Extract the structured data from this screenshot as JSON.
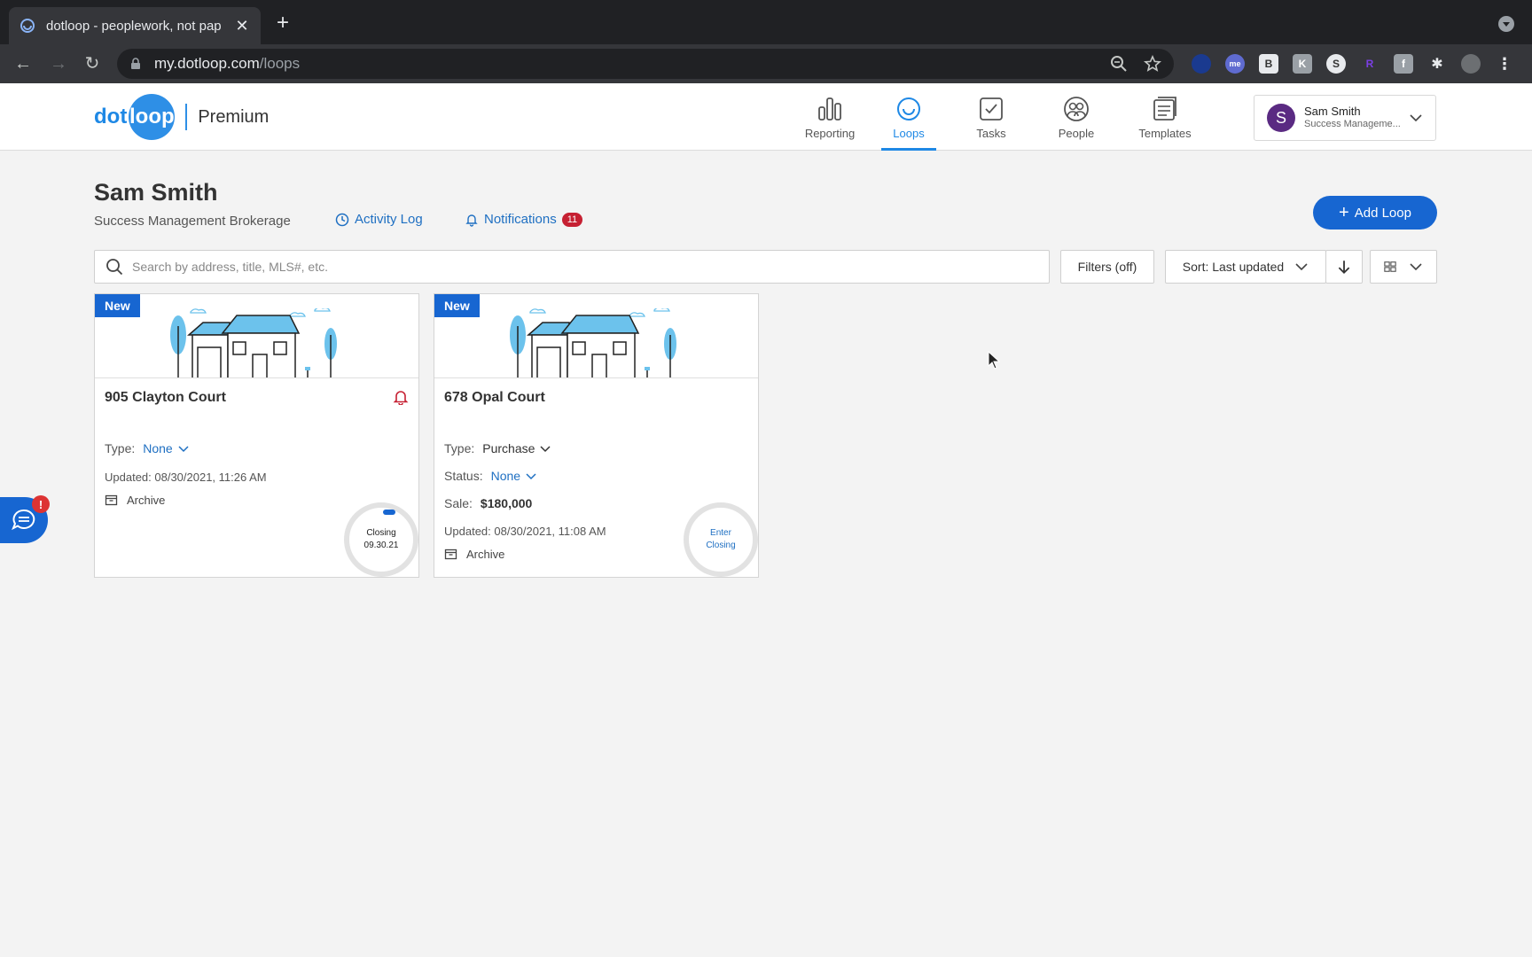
{
  "browser": {
    "tab_title": "dotloop - peoplework, not pap",
    "url_host": "my.dotloop.com",
    "url_path": "/loops"
  },
  "header": {
    "logo_dot": "dot",
    "logo_loop": "loop",
    "plan": "Premium",
    "nav": [
      {
        "label": "Reporting",
        "icon": "bar-chart-icon"
      },
      {
        "label": "Loops",
        "icon": "loop-icon",
        "active": true
      },
      {
        "label": "Tasks",
        "icon": "checkbox-icon"
      },
      {
        "label": "People",
        "icon": "people-icon"
      },
      {
        "label": "Templates",
        "icon": "templates-icon"
      }
    ],
    "user": {
      "initial": "S",
      "name": "Sam Smith",
      "org": "Success Manageme..."
    }
  },
  "page": {
    "title": "Sam Smith",
    "brokerage": "Success Management Brokerage",
    "activity_log": "Activity Log",
    "notifications": "Notifications",
    "notifications_count": "11",
    "add_loop": "Add Loop"
  },
  "controls": {
    "search_placeholder": "Search by address, title, MLS#, etc.",
    "filters": "Filters (off)",
    "sort": "Sort: Last updated"
  },
  "loops": [
    {
      "tag": "New",
      "address": "905 Clayton Court",
      "type_label": "Type:",
      "type_value": "None",
      "updated": "Updated: 08/30/2021, 11:26 AM",
      "archive": "Archive",
      "ring_line1": "Closing",
      "ring_line2": "09.30.21"
    },
    {
      "tag": "New",
      "address": "678 Opal Court",
      "type_label": "Type:",
      "type_value": "Purchase",
      "status_label": "Status:",
      "status_value": "None",
      "sale_label": "Sale:",
      "sale_value": "$180,000",
      "updated": "Updated: 08/30/2021, 11:08 AM",
      "archive": "Archive",
      "ring_line1": "Enter",
      "ring_line2": "Closing"
    }
  ],
  "chat": {
    "badge": "!"
  },
  "colors": {
    "brand_blue": "#1766d1",
    "link_blue": "#1e6fc2",
    "badge_red": "#c62032"
  }
}
